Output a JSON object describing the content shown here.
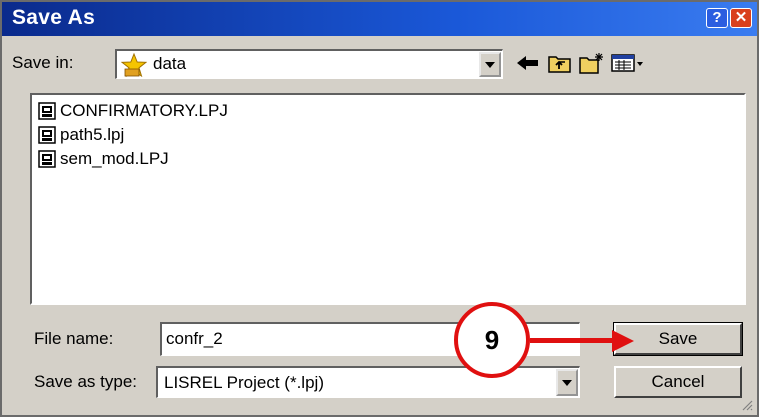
{
  "window": {
    "title": "Save As"
  },
  "titlebar": {
    "help_label": "?",
    "close_label": "✕"
  },
  "toolbar": {
    "save_in_label": "Save in:",
    "save_in_value": "data",
    "icons": [
      "back-arrow-icon",
      "up-folder-icon",
      "new-folder-icon",
      "view-menu-icon"
    ]
  },
  "files": [
    {
      "name": "CONFIRMATORY.LPJ",
      "icon": "lisrel-project-file-icon"
    },
    {
      "name": "path5.lpj",
      "icon": "lisrel-project-file-icon"
    },
    {
      "name": "sem_mod.LPJ",
      "icon": "lisrel-project-file-icon"
    }
  ],
  "filename": {
    "label": "File name:",
    "value": "confr_2"
  },
  "filetype": {
    "label": "Save as type:",
    "value": "LISREL Project (*.lpj)"
  },
  "buttons": {
    "save": "Save",
    "cancel": "Cancel"
  },
  "annotation": {
    "step_number": "9",
    "color": "#e01010"
  },
  "colors": {
    "titlebar": "#1a58d8",
    "dialog": "#d4d0c8",
    "accent": "#e01010"
  }
}
